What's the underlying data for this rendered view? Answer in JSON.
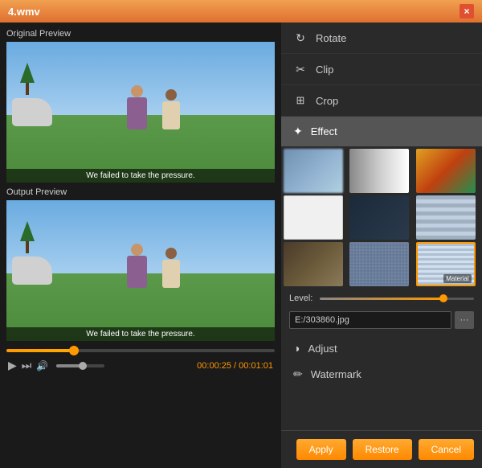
{
  "titlebar": {
    "title": "4.wmv",
    "close_label": "×"
  },
  "left": {
    "original_label": "Original Preview",
    "output_label": "Output Preview",
    "subtitle": "We failed to take the pressure.",
    "time_current": "00:00:25",
    "time_total": "00:01:01",
    "time_separator": " / "
  },
  "right": {
    "tools": [
      {
        "id": "rotate",
        "label": "Rotate",
        "icon": "↻"
      },
      {
        "id": "clip",
        "label": "Clip",
        "icon": "✂"
      },
      {
        "id": "crop",
        "label": "Crop",
        "icon": "⊞"
      }
    ],
    "effect_header": "Effect",
    "effects": [
      {
        "id": "blur",
        "class": "thumb-blur",
        "label": ""
      },
      {
        "id": "bw",
        "class": "thumb-bw",
        "label": ""
      },
      {
        "id": "color1",
        "class": "thumb-color1",
        "label": ""
      },
      {
        "id": "sketch",
        "class": "thumb-sketch",
        "label": ""
      },
      {
        "id": "dark",
        "class": "thumb-dark",
        "label": ""
      },
      {
        "id": "mosaic",
        "class": "thumb-mosaic",
        "label": ""
      },
      {
        "id": "film",
        "class": "thumb-film",
        "label": ""
      },
      {
        "id": "pixel",
        "class": "thumb-pixel",
        "label": ""
      },
      {
        "id": "material",
        "class": "thumb-material",
        "label": "Material",
        "selected": true
      }
    ],
    "level_label": "Level:",
    "filepath": "E:/303860.jpg",
    "filepath_btn": "···",
    "adjust_label": "Adjust",
    "watermark_label": "Watermark",
    "buttons": {
      "apply": "Apply",
      "restore": "Restore",
      "cancel": "Cancel"
    }
  }
}
